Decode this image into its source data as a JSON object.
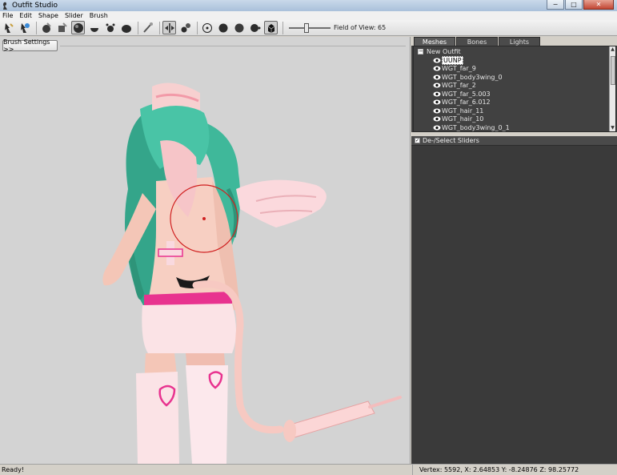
{
  "window": {
    "title": "Outfit Studio",
    "icon": "outfit-studio-app-icon",
    "controls": {
      "minimize": "−",
      "maximize": "□",
      "close": "✕"
    }
  },
  "menu": {
    "items": [
      "File",
      "Edit",
      "Shape",
      "Slider",
      "Brush"
    ]
  },
  "toolbar": {
    "buttons": [
      "select-tool-icon",
      "transform-tool-icon",
      "standard-brush-icon",
      "mask-brush-icon",
      "inflate-brush-icon",
      "deflate-brush-icon",
      "move-brush-icon",
      "smooth-brush-icon",
      "weight-brush-icon",
      "color-brush-icon",
      "mirror-icon",
      "weld-icon",
      "vertex-view-icon",
      "shaded-view-icon",
      "texture-view-icon",
      "lighting-view-icon",
      "wireframe-icon"
    ],
    "fov_label": "Field of View: 65",
    "fov_value": 65
  },
  "viewport": {
    "brush_settings_label": "Brush Settings >>"
  },
  "tabs": [
    {
      "label": "Meshes",
      "active": true
    },
    {
      "label": "Bones",
      "active": false
    },
    {
      "label": "Lights",
      "active": false
    }
  ],
  "outfit_tree": {
    "root_label": "New Outfit",
    "expander": "−",
    "items": [
      {
        "label": "UUNP",
        "selected": true
      },
      {
        "label": "WGT_far_9",
        "selected": false
      },
      {
        "label": "WGT_body3wing_0",
        "selected": false
      },
      {
        "label": "WGT_far_2",
        "selected": false
      },
      {
        "label": "WGT_far_5.003",
        "selected": false
      },
      {
        "label": "WGT_far_6.012",
        "selected": false
      },
      {
        "label": "WGT_hair_11",
        "selected": false
      },
      {
        "label": "WGT_hair_10",
        "selected": false
      },
      {
        "label": "WGT_body3wing_0_1",
        "selected": false
      }
    ]
  },
  "sliders_panel": {
    "header_label": "De-/Select Sliders",
    "checkbox_mark": "✓"
  },
  "status": {
    "left": "Ready!",
    "right": "Vertex: 5592, X: 2.64853 Y: -8.24876 Z: 98.25772"
  },
  "colors": {
    "viewport_bg": "#d3d3d3",
    "panel_bg": "#3c3c3c",
    "hair": "#3fb89a",
    "skin": "#f4c6b7",
    "brush_circle": "#d02020",
    "outfit_pink": "#e8338f"
  }
}
